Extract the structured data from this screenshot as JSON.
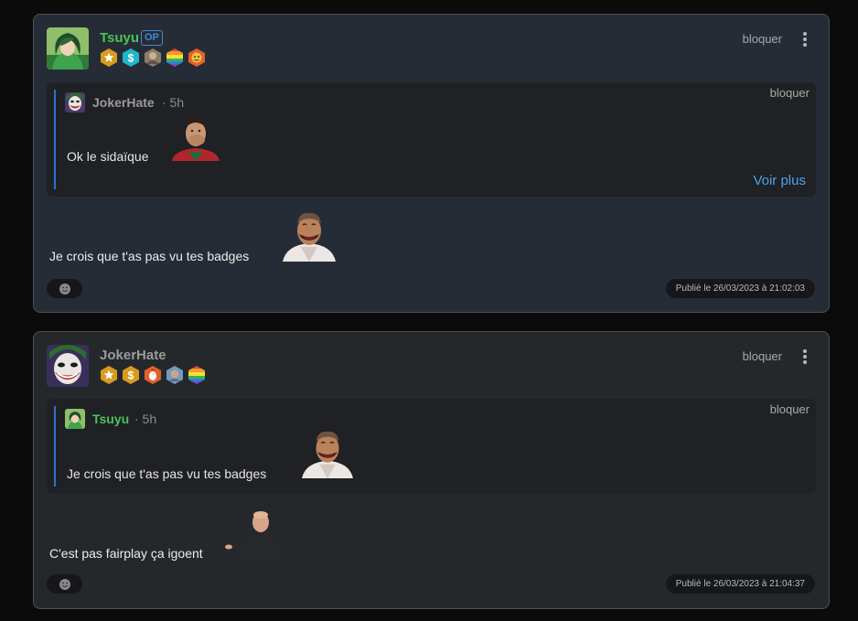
{
  "posts": [
    {
      "author": "Tsuyu",
      "op_tag": "OP",
      "block_label": "bloquer",
      "badges": [
        "star-badge-icon",
        "dollar-badge-icon",
        "portrait-badge-icon",
        "rainbow-badge-icon",
        "face-badge-icon"
      ],
      "quote": {
        "author": "JokerHate",
        "time": "· 5h",
        "block_label": "bloquer",
        "text": "Ok le sidaïque",
        "more_label": "Voir plus"
      },
      "body": "Je crois que t'as pas vu tes badges",
      "published": "Publié le 26/03/2023 à 21:02:03"
    },
    {
      "author": "JokerHate",
      "block_label": "bloquer",
      "badges": [
        "star-badge-icon",
        "dollar-badge-icon",
        "chicken-badge-icon",
        "portrait-badge-icon",
        "rainbow-badge-icon"
      ],
      "quote": {
        "author": "Tsuyu",
        "time": "· 5h",
        "block_label": "bloquer",
        "text": "Je crois que t'as pas vu tes badges"
      },
      "body": "C'est pas fairplay ça igoent",
      "published": "Publié le 26/03/2023 à 21:04:37"
    }
  ],
  "colors": {
    "op_name": "#4cc25a",
    "other_name": "#9a9a9a",
    "link": "#4aa3ee",
    "quote_bar": "#2f6fd1"
  }
}
